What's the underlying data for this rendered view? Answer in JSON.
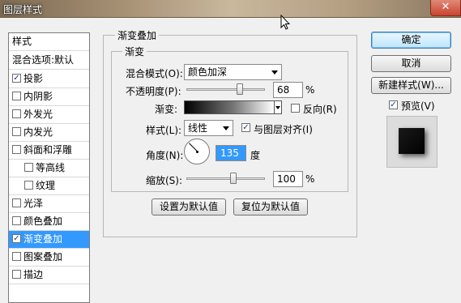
{
  "window": {
    "title": "图层样式",
    "close_label": "✕"
  },
  "style_list": {
    "header": "样式",
    "blend_options": "混合选项:默认",
    "items": [
      {
        "label": "投影",
        "checked": true
      },
      {
        "label": "内阴影",
        "checked": false
      },
      {
        "label": "外发光",
        "checked": false
      },
      {
        "label": "内发光",
        "checked": false
      },
      {
        "label": "斜面和浮雕",
        "checked": false
      },
      {
        "label": "等高线",
        "checked": false
      },
      {
        "label": "纹理",
        "checked": false
      },
      {
        "label": "光泽",
        "checked": false
      },
      {
        "label": "颜色叠加",
        "checked": false
      },
      {
        "label": "渐变叠加",
        "checked": true,
        "selected": true
      },
      {
        "label": "图案叠加",
        "checked": false
      },
      {
        "label": "描边",
        "checked": false
      }
    ]
  },
  "gradient_overlay": {
    "group_title": "渐变叠加",
    "subgroup_title": "渐变",
    "blend_mode_label": "混合模式(O):",
    "blend_mode_value": "颜色加深",
    "opacity_label": "不透明度(P):",
    "opacity_value": "68",
    "opacity_unit": "%",
    "opacity_level": 0.68,
    "gradient_label": "渐变:",
    "reverse_label": "反向(R)",
    "reverse_checked": false,
    "style_label": "样式(L):",
    "style_value": "线性",
    "align_label": "与图层对齐(I)",
    "align_checked": true,
    "angle_label": "角度(N):",
    "angle_value": "135",
    "angle_unit": "度",
    "scale_label": "缩放(S):",
    "scale_value": "100",
    "scale_unit": "%",
    "scale_level": 0.6,
    "make_default_label": "设置为默认值",
    "reset_default_label": "复位为默认值"
  },
  "actions": {
    "ok_label": "确定",
    "cancel_label": "取消",
    "new_style_label": "新建样式(W)...",
    "preview_label": "预览(V)",
    "preview_checked": true
  },
  "colors": {
    "selection": "#3399ff",
    "gradient_start": "#000000",
    "gradient_end": "#ffffff"
  }
}
